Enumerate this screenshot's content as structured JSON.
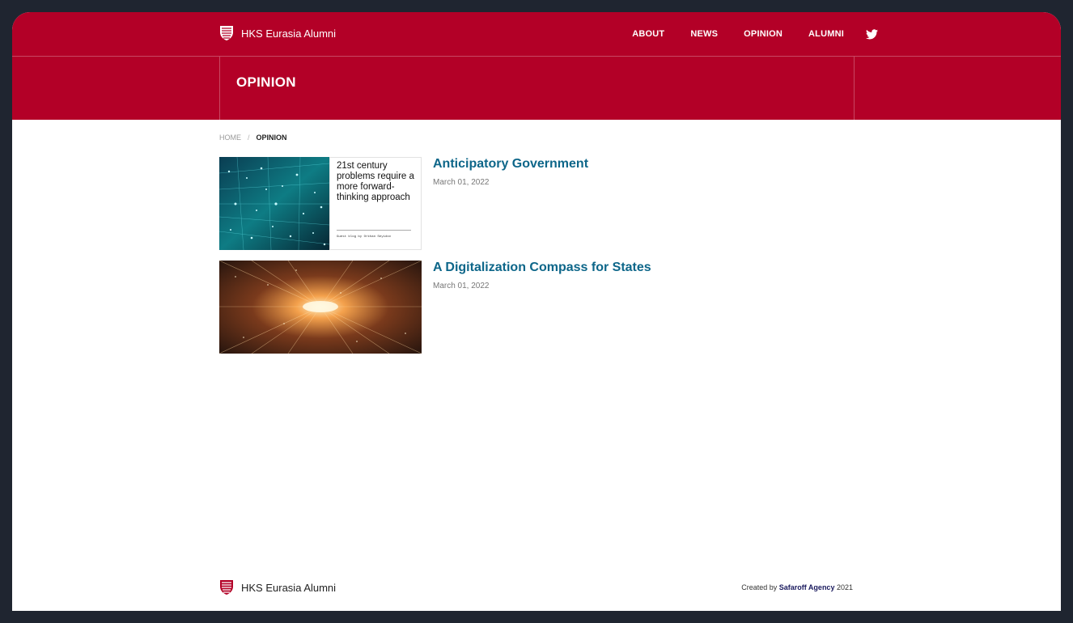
{
  "brand": {
    "name": "HKS Eurasia Alumni"
  },
  "nav": {
    "items": [
      "ABOUT",
      "NEWS",
      "OPINION",
      "ALUMNI"
    ],
    "twitter_icon": "twitter-icon"
  },
  "page": {
    "title": "OPINION"
  },
  "breadcrumb": {
    "home": "HOME",
    "separator": "/",
    "current": "OPINION"
  },
  "articles": [
    {
      "title": "Anticipatory Government",
      "date": "March 01, 2022",
      "thumb_headline": "21st century problems require a more forward-thinking approach",
      "thumb_byline": "Guest blog by Orkhan Seyidov"
    },
    {
      "title": "A Digitalization Compass for States",
      "date": "March 01, 2022"
    }
  ],
  "footer": {
    "brand": "HKS Eurasia Alumni",
    "credit_prefix": "Created by",
    "credit_agency": "Safaroff Agency",
    "credit_year": "2021"
  },
  "colors": {
    "primary": "#b30027",
    "link": "#0d6689",
    "frame": "#1f2530"
  }
}
